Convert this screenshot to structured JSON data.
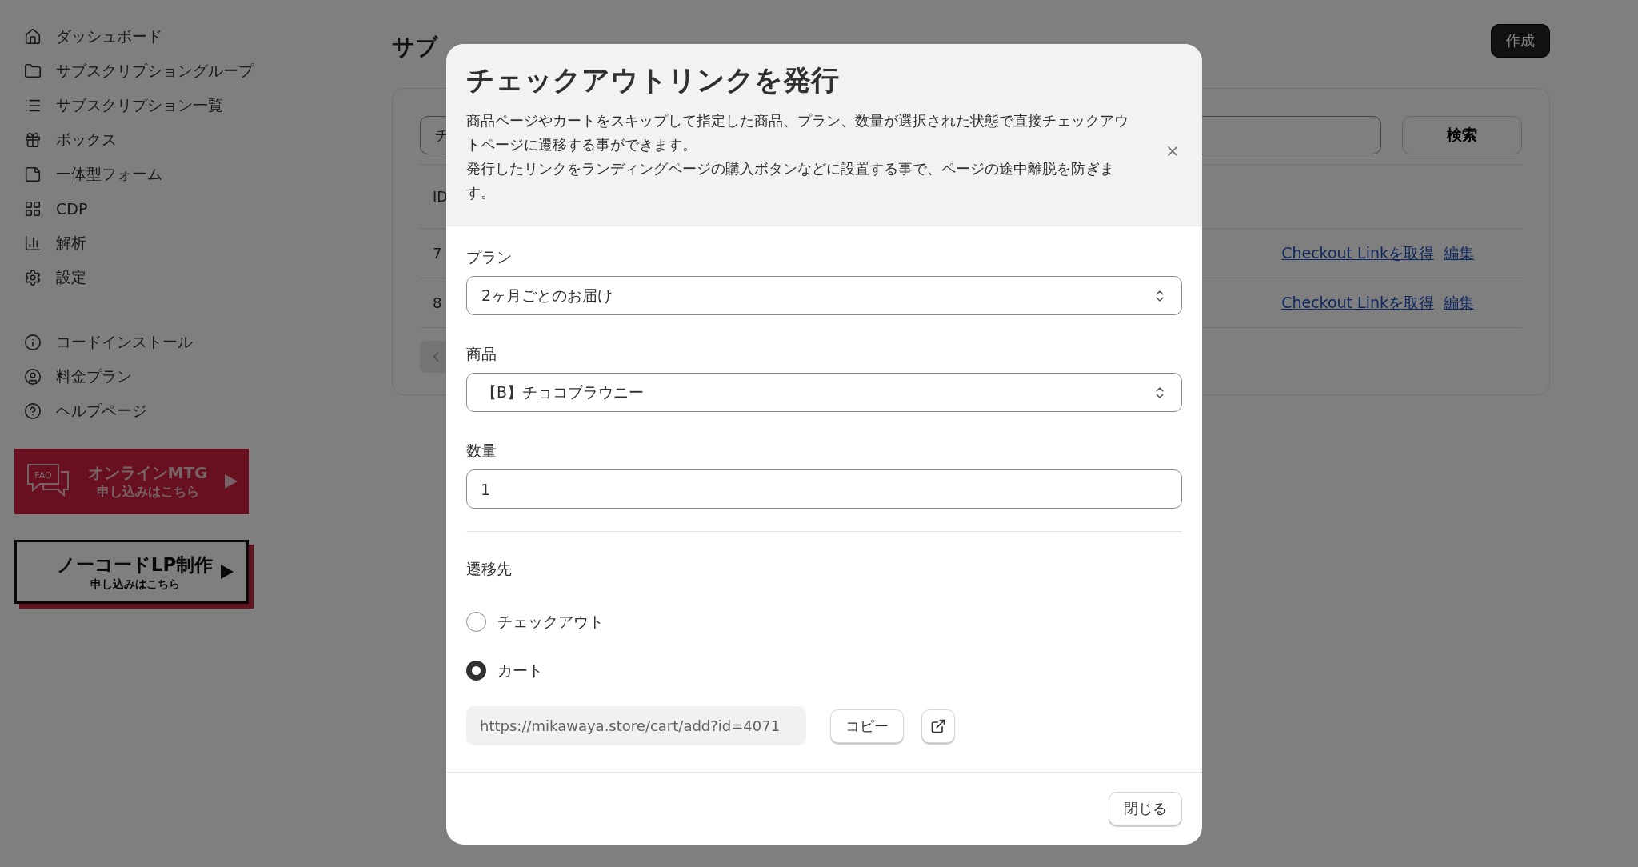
{
  "sidebar": {
    "items": [
      {
        "label": "ダッシュボード"
      },
      {
        "label": "サブスクリプショングループ"
      },
      {
        "label": "サブスクリプション一覧"
      },
      {
        "label": "ボックス"
      },
      {
        "label": "一体型フォーム"
      },
      {
        "label": "CDP"
      },
      {
        "label": "解析"
      },
      {
        "label": "設定"
      }
    ],
    "help_items": [
      {
        "label": "コードインストール"
      },
      {
        "label": "料金プラン"
      },
      {
        "label": "ヘルプページ"
      }
    ],
    "banners": [
      {
        "kind": "mtg",
        "badge": "FAQ",
        "title": "オンラインMTG",
        "subtitle": "申し込みはこちら"
      },
      {
        "kind": "lp",
        "title": "ノーコードLP制作",
        "subtitle": "申し込みはこちら"
      }
    ]
  },
  "page": {
    "title": "サブ",
    "create_button": "作成",
    "search": {
      "value": "チ",
      "button": "検索"
    },
    "table": {
      "header": "ID",
      "rows": [
        {
          "id": "7",
          "links": [
            "Checkout Linkを取得",
            "編集"
          ]
        },
        {
          "id": "8",
          "links": [
            "Checkout Linkを取得",
            "編集"
          ]
        }
      ]
    }
  },
  "modal": {
    "title": "チェックアウトリンクを発行",
    "description": [
      "商品ページやカートをスキップして指定した商品、プラン、数量が選択された状態で直接チェックアウトページに遷移する事ができます。",
      "発行したリンクをランディングページの購入ボタンなどに設置する事で、ページの途中離脱を防ぎます。"
    ],
    "fields": [
      {
        "label": "プラン",
        "kind": "select",
        "value": "2ヶ月ごとのお届け"
      },
      {
        "label": "商品",
        "kind": "select",
        "value": "【B】チョコブラウニー"
      },
      {
        "label": "数量",
        "kind": "input",
        "value": "1"
      }
    ],
    "destination": {
      "label": "遷移先",
      "options": [
        {
          "label": "チェックアウト",
          "selected": false
        },
        {
          "label": "カート",
          "selected": true
        }
      ]
    },
    "link": {
      "value": "https://mikawaya.store/cart/add?id=4071",
      "copy_button": "コピー"
    },
    "close_button": "閉じる"
  }
}
